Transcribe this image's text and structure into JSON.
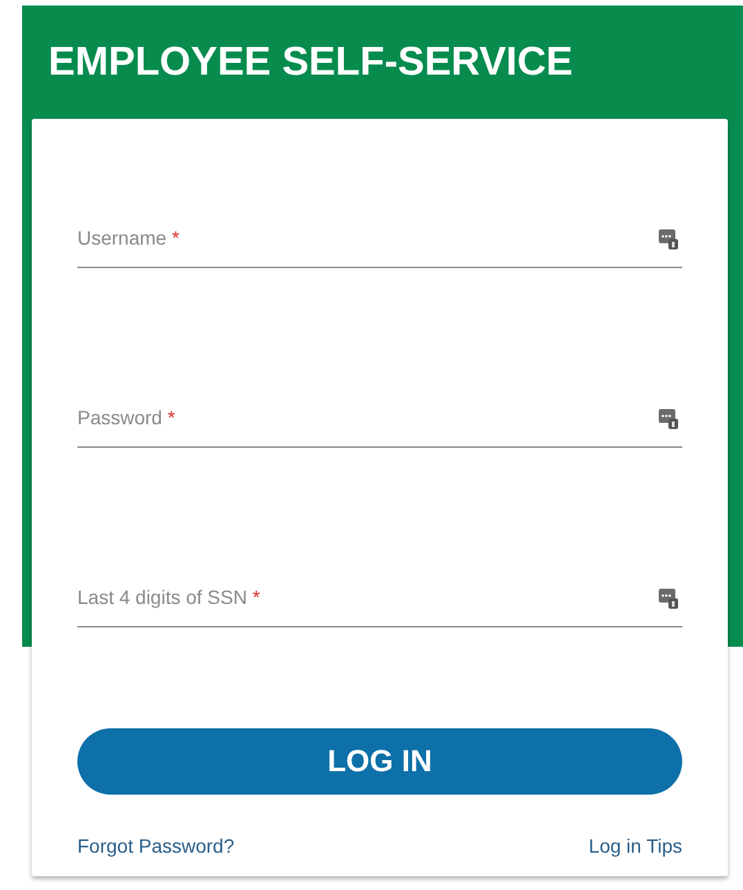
{
  "header": {
    "title": "EMPLOYEE SELF-SERVICE"
  },
  "fields": [
    {
      "placeholder": "Username",
      "required_mark": "*"
    },
    {
      "placeholder": "Password",
      "required_mark": "*"
    },
    {
      "placeholder": "Last 4 digits of SSN",
      "required_mark": "*"
    }
  ],
  "login_button": "LOG IN",
  "links": [
    "Forgot Password?",
    "Log in Tips"
  ]
}
